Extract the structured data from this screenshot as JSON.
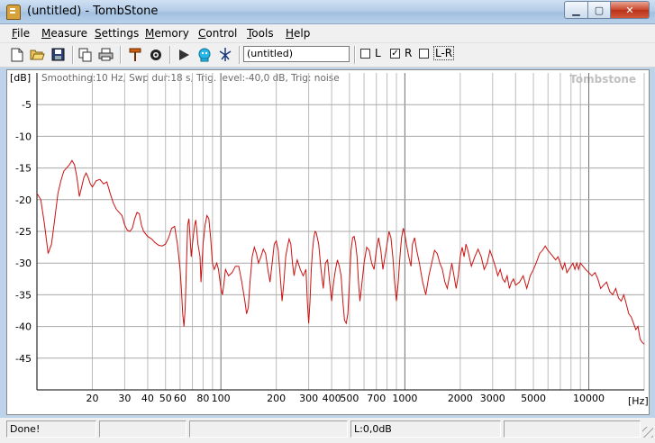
{
  "window": {
    "title": "(untitled) - TombStone",
    "buttons": {
      "minimize": "▁",
      "maximize": "▢",
      "close": "✕"
    }
  },
  "menu": [
    {
      "label": "File"
    },
    {
      "label": "Measure"
    },
    {
      "label": "Settings"
    },
    {
      "label": "Memory"
    },
    {
      "label": "Control"
    },
    {
      "label": "Tools"
    },
    {
      "label": "Help"
    }
  ],
  "toolbar": {
    "name_value": "(untitled)",
    "icons": [
      "new-file-icon",
      "open-folder-icon",
      "save-icon",
      "copy-icon",
      "print-icon",
      "marker-icon",
      "target-icon",
      "play-icon",
      "robot-icon",
      "antenna-icon"
    ],
    "checks": [
      {
        "label": "L",
        "checked": false
      },
      {
        "label": "R",
        "checked": true
      },
      {
        "label": "L-R",
        "checked": false
      }
    ]
  },
  "chart_data": {
    "type": "line",
    "info": "Smoothing:10 Hz, Swp dur:18 s, Trig. level:-40,0 dB, Trig: noise",
    "watermark": "Tombstone",
    "ylabel": "[dB]",
    "xlabel": "[Hz]",
    "xscale": "log",
    "xlim": [
      10,
      20000
    ],
    "ylim": [
      -50,
      0
    ],
    "yticks": [
      -5,
      -10,
      -15,
      -20,
      -25,
      -30,
      -35,
      -40,
      -45
    ],
    "xticks": [
      {
        "v": 20,
        "label": "20"
      },
      {
        "v": 30,
        "label": "30"
      },
      {
        "v": 40,
        "label": "40"
      },
      {
        "v": 50,
        "label": "50"
      },
      {
        "v": 60,
        "label": "60"
      },
      {
        "v": 80,
        "label": "80"
      },
      {
        "v": 100,
        "label": "100"
      },
      {
        "v": 200,
        "label": "200"
      },
      {
        "v": 300,
        "label": "300"
      },
      {
        "v": 400,
        "label": "400"
      },
      {
        "v": 500,
        "label": "500"
      },
      {
        "v": 700,
        "label": "700"
      },
      {
        "v": 1000,
        "label": "1000"
      },
      {
        "v": 2000,
        "label": "2000"
      },
      {
        "v": 3000,
        "label": "3000"
      },
      {
        "v": 5000,
        "label": "5000"
      },
      {
        "v": 10000,
        "label": "10000"
      }
    ],
    "grid": true,
    "series": [
      {
        "color": "#cc1111",
        "points": [
          [
            10,
            -19
          ],
          [
            10.5,
            -20
          ],
          [
            11,
            -24
          ],
          [
            11.5,
            -28.5
          ],
          [
            12,
            -27
          ],
          [
            12.5,
            -23
          ],
          [
            13,
            -19
          ],
          [
            13.5,
            -17
          ],
          [
            14,
            -15.5
          ],
          [
            15,
            -14.5
          ],
          [
            15.5,
            -13.8
          ],
          [
            16,
            -14.5
          ],
          [
            16.5,
            -16.5
          ],
          [
            17,
            -19.5
          ],
          [
            17.5,
            -18
          ],
          [
            18,
            -16.5
          ],
          [
            18.5,
            -15.8
          ],
          [
            19,
            -16.5
          ],
          [
            19.5,
            -17.5
          ],
          [
            20,
            -18
          ],
          [
            21,
            -17
          ],
          [
            22,
            -16.8
          ],
          [
            23,
            -17.5
          ],
          [
            24,
            -17.2
          ],
          [
            25,
            -19
          ],
          [
            26,
            -20.5
          ],
          [
            27,
            -21.5
          ],
          [
            28,
            -22
          ],
          [
            29,
            -22.5
          ],
          [
            30,
            -24
          ],
          [
            31,
            -24.8
          ],
          [
            32,
            -25
          ],
          [
            33,
            -24.5
          ],
          [
            34,
            -23
          ],
          [
            35,
            -22
          ],
          [
            36,
            -22.2
          ],
          [
            37,
            -24
          ],
          [
            38,
            -25
          ],
          [
            40,
            -25.8
          ],
          [
            42,
            -26.2
          ],
          [
            44,
            -26.8
          ],
          [
            46,
            -27.2
          ],
          [
            48,
            -27.3
          ],
          [
            50,
            -27
          ],
          [
            52,
            -26
          ],
          [
            54,
            -24.5
          ],
          [
            56,
            -24.2
          ],
          [
            58,
            -27
          ],
          [
            60,
            -31
          ],
          [
            61,
            -34
          ],
          [
            62,
            -38
          ],
          [
            63,
            -40
          ],
          [
            64,
            -37
          ],
          [
            65,
            -30
          ],
          [
            66,
            -24
          ],
          [
            67,
            -23
          ],
          [
            68,
            -26
          ],
          [
            69,
            -29
          ],
          [
            70,
            -27
          ],
          [
            72,
            -24
          ],
          [
            73,
            -23.2
          ],
          [
            74,
            -25
          ],
          [
            75,
            -27
          ],
          [
            77,
            -29
          ],
          [
            78,
            -33
          ],
          [
            79,
            -30
          ],
          [
            80,
            -27
          ],
          [
            82,
            -24
          ],
          [
            84,
            -22.5
          ],
          [
            86,
            -23
          ],
          [
            88,
            -26
          ],
          [
            90,
            -30
          ],
          [
            92,
            -31
          ],
          [
            95,
            -30
          ],
          [
            97,
            -31
          ],
          [
            100,
            -34
          ],
          [
            102,
            -35
          ],
          [
            104,
            -33
          ],
          [
            106,
            -31
          ],
          [
            110,
            -32
          ],
          [
            115,
            -31.5
          ],
          [
            120,
            -30.5
          ],
          [
            125,
            -30.5
          ],
          [
            130,
            -33
          ],
          [
            135,
            -36
          ],
          [
            138,
            -38
          ],
          [
            141,
            -37
          ],
          [
            144,
            -33
          ],
          [
            148,
            -29
          ],
          [
            152,
            -27.5
          ],
          [
            156,
            -28.5
          ],
          [
            160,
            -30
          ],
          [
            165,
            -29
          ],
          [
            170,
            -27.8
          ],
          [
            175,
            -28.5
          ],
          [
            180,
            -31
          ],
          [
            185,
            -33
          ],
          [
            190,
            -30
          ],
          [
            195,
            -27
          ],
          [
            200,
            -26.5
          ],
          [
            205,
            -28
          ],
          [
            210,
            -32
          ],
          [
            215,
            -36
          ],
          [
            220,
            -33
          ],
          [
            225,
            -29
          ],
          [
            230,
            -27.5
          ],
          [
            235,
            -26.2
          ],
          [
            240,
            -27
          ],
          [
            245,
            -30
          ],
          [
            250,
            -32
          ],
          [
            255,
            -30.5
          ],
          [
            260,
            -29.5
          ],
          [
            270,
            -31
          ],
          [
            280,
            -32
          ],
          [
            290,
            -31
          ],
          [
            295,
            -36
          ],
          [
            300,
            -39.5
          ],
          [
            305,
            -36
          ],
          [
            310,
            -31
          ],
          [
            315,
            -28
          ],
          [
            320,
            -26
          ],
          [
            325,
            -25
          ],
          [
            330,
            -25.2
          ],
          [
            340,
            -27
          ],
          [
            350,
            -31
          ],
          [
            360,
            -34
          ],
          [
            370,
            -30
          ],
          [
            380,
            -29.5
          ],
          [
            390,
            -33
          ],
          [
            400,
            -36
          ],
          [
            410,
            -33
          ],
          [
            420,
            -31
          ],
          [
            430,
            -29.5
          ],
          [
            440,
            -30.5
          ],
          [
            450,
            -32
          ],
          [
            460,
            -36
          ],
          [
            470,
            -39
          ],
          [
            480,
            -39.5
          ],
          [
            490,
            -38
          ],
          [
            500,
            -33
          ],
          [
            510,
            -28
          ],
          [
            520,
            -26
          ],
          [
            530,
            -25.8
          ],
          [
            540,
            -27
          ],
          [
            550,
            -29
          ],
          [
            560,
            -33
          ],
          [
            570,
            -36
          ],
          [
            580,
            -34
          ],
          [
            600,
            -30
          ],
          [
            620,
            -27.5
          ],
          [
            640,
            -28
          ],
          [
            660,
            -30
          ],
          [
            680,
            -31
          ],
          [
            700,
            -28
          ],
          [
            720,
            -26
          ],
          [
            740,
            -28
          ],
          [
            760,
            -31
          ],
          [
            780,
            -29
          ],
          [
            800,
            -27
          ],
          [
            820,
            -25
          ],
          [
            840,
            -26
          ],
          [
            860,
            -29
          ],
          [
            880,
            -33
          ],
          [
            900,
            -36
          ],
          [
            920,
            -33
          ],
          [
            940,
            -29
          ],
          [
            960,
            -26
          ],
          [
            980,
            -24.5
          ],
          [
            1000,
            -25.5
          ],
          [
            1020,
            -27
          ],
          [
            1050,
            -29
          ],
          [
            1080,
            -30.5
          ],
          [
            1100,
            -27
          ],
          [
            1130,
            -26
          ],
          [
            1160,
            -28
          ],
          [
            1200,
            -30
          ],
          [
            1250,
            -33
          ],
          [
            1300,
            -35
          ],
          [
            1350,
            -32
          ],
          [
            1400,
            -30
          ],
          [
            1450,
            -28
          ],
          [
            1500,
            -28.5
          ],
          [
            1550,
            -30
          ],
          [
            1600,
            -31
          ],
          [
            1650,
            -33
          ],
          [
            1700,
            -34
          ],
          [
            1750,
            -32
          ],
          [
            1800,
            -30
          ],
          [
            1850,
            -32
          ],
          [
            1900,
            -34
          ],
          [
            1950,
            -32
          ],
          [
            2000,
            -29
          ],
          [
            2050,
            -27.5
          ],
          [
            2100,
            -29
          ],
          [
            2150,
            -27
          ],
          [
            2200,
            -28
          ],
          [
            2300,
            -30.5
          ],
          [
            2400,
            -29
          ],
          [
            2500,
            -27.8
          ],
          [
            2600,
            -29
          ],
          [
            2700,
            -31
          ],
          [
            2800,
            -30
          ],
          [
            2900,
            -28
          ],
          [
            3000,
            -29.2
          ],
          [
            3100,
            -30.5
          ],
          [
            3200,
            -32
          ],
          [
            3300,
            -31
          ],
          [
            3400,
            -32.5
          ],
          [
            3500,
            -33
          ],
          [
            3600,
            -32
          ],
          [
            3700,
            -34
          ],
          [
            3800,
            -33
          ],
          [
            3900,
            -32.5
          ],
          [
            4000,
            -33.5
          ],
          [
            4200,
            -33
          ],
          [
            4400,
            -32
          ],
          [
            4600,
            -34
          ],
          [
            4800,
            -32
          ],
          [
            5000,
            -31
          ],
          [
            5200,
            -29.8
          ],
          [
            5400,
            -28.5
          ],
          [
            5600,
            -28
          ],
          [
            5800,
            -27.3
          ],
          [
            6000,
            -28
          ],
          [
            6200,
            -28.5
          ],
          [
            6400,
            -29
          ],
          [
            6600,
            -29.5
          ],
          [
            6800,
            -29
          ],
          [
            7000,
            -30
          ],
          [
            7200,
            -31
          ],
          [
            7400,
            -30
          ],
          [
            7600,
            -31.5
          ],
          [
            7800,
            -31
          ],
          [
            8000,
            -30.5
          ],
          [
            8200,
            -30
          ],
          [
            8400,
            -31
          ],
          [
            8600,
            -30
          ],
          [
            8800,
            -31
          ],
          [
            9000,
            -30
          ],
          [
            9300,
            -30.5
          ],
          [
            9600,
            -31
          ],
          [
            10000,
            -31.5
          ],
          [
            10400,
            -32
          ],
          [
            10800,
            -31.5
          ],
          [
            11200,
            -32.5
          ],
          [
            11600,
            -34
          ],
          [
            12000,
            -33.5
          ],
          [
            12500,
            -33
          ],
          [
            13000,
            -34.5
          ],
          [
            13500,
            -35
          ],
          [
            14000,
            -34
          ],
          [
            14500,
            -35.5
          ],
          [
            15000,
            -36
          ],
          [
            15500,
            -35
          ],
          [
            16000,
            -36.5
          ],
          [
            16500,
            -38
          ],
          [
            17000,
            -38.5
          ],
          [
            17500,
            -39.5
          ],
          [
            18000,
            -40.5
          ],
          [
            18500,
            -40
          ],
          [
            19000,
            -42
          ],
          [
            19500,
            -42.5
          ],
          [
            20000,
            -42.8
          ]
        ]
      }
    ]
  },
  "status": {
    "message": "Done!",
    "pane2": "",
    "pane3": "",
    "level": "L:0,0dB",
    "pane5": ""
  }
}
